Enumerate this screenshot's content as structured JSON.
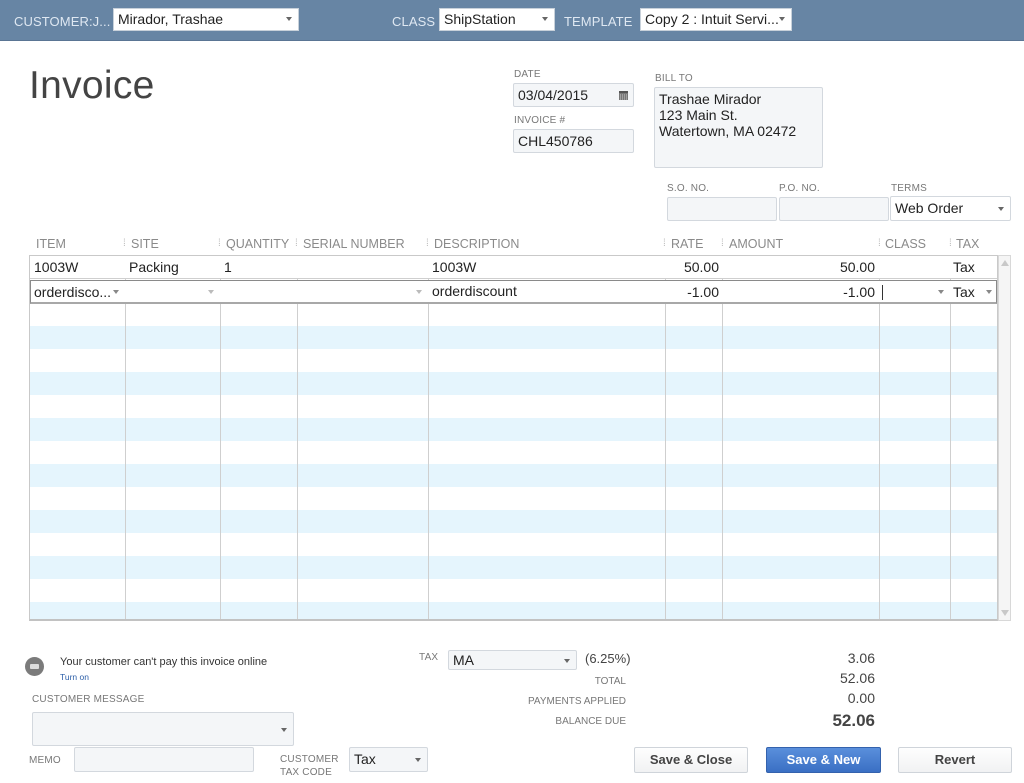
{
  "header": {
    "customer_label": "CUSTOMER:J...",
    "customer_value": "Mirador, Trashae",
    "class_label": "CLASS",
    "class_value": "ShipStation",
    "template_label": "TEMPLATE",
    "template_value": "Copy 2 : Intuit Servi..."
  },
  "title": "Invoice",
  "date": {
    "label": "DATE",
    "value": "03/04/2015",
    "icon": "calendar-icon"
  },
  "invoice_no": {
    "label": "INVOICE #",
    "value": "CHL450786"
  },
  "bill_to": {
    "label": "BILL TO",
    "lines": [
      "Trashae Mirador",
      "123 Main St.",
      "Watertown, MA  02472"
    ]
  },
  "so_no": {
    "label": "S.O. NO.",
    "value": ""
  },
  "po_no": {
    "label": "P.O. NO.",
    "value": ""
  },
  "terms": {
    "label": "TERMS",
    "value": "Web Order"
  },
  "grid": {
    "columns": [
      "ITEM",
      "SITE",
      "QUANTITY",
      "SERIAL NUMBER",
      "DESCRIPTION",
      "RATE",
      "AMOUNT",
      "CLASS",
      "TAX"
    ],
    "rows": [
      {
        "item": "1003W",
        "site": "Packing",
        "quantity": "1",
        "serial": "",
        "description": "1003W",
        "rate": "50.00",
        "amount": "50.00",
        "class": "",
        "tax": "Tax"
      },
      {
        "item": "orderdisco...",
        "site": "",
        "quantity": "",
        "serial": "",
        "description": "orderdiscount",
        "rate": "-1.00",
        "amount": "-1.00",
        "class": "",
        "tax": "Tax"
      }
    ]
  },
  "online_payment": {
    "message": "Your customer can't pay this invoice online",
    "link": "Turn on",
    "icon": "payment-card-icon"
  },
  "customer_message": {
    "label": "CUSTOMER MESSAGE",
    "value": ""
  },
  "memo": {
    "label": "MEMO",
    "value": ""
  },
  "customer_tax_code": {
    "label_line1": "CUSTOMER",
    "label_line2": "TAX CODE",
    "value": "Tax"
  },
  "tax": {
    "label": "TAX",
    "value": "MA",
    "rate": "(6.25%)",
    "amount": "3.06"
  },
  "totals": {
    "total_label": "TOTAL",
    "total": "52.06",
    "payments_label": "PAYMENTS APPLIED",
    "payments": "0.00",
    "balance_label": "BALANCE DUE",
    "balance": "52.06"
  },
  "buttons": {
    "save_close": "Save & Close",
    "save_new": "Save & New",
    "revert": "Revert"
  }
}
